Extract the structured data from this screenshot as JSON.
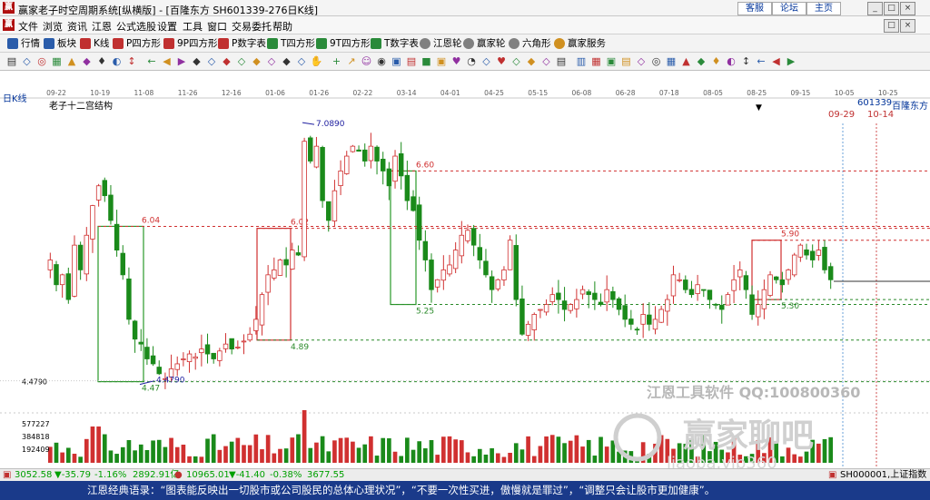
{
  "window": {
    "title": "赢家老子时空周期系统[纵横版] - [百隆东方 SH601339-276日K线]",
    "logo": "赢",
    "links": [
      "客服",
      "论坛",
      "主页"
    ]
  },
  "menu": {
    "items": [
      "文件",
      "浏览",
      "资讯",
      "江恩",
      "公式选股",
      "设置",
      "工具",
      "窗口",
      "交易委托",
      "帮助"
    ]
  },
  "toolbar": {
    "items": [
      {
        "label": "行情",
        "color": "#2a5caa"
      },
      {
        "label": "板块",
        "color": "#2a5caa"
      },
      {
        "label": "K线",
        "color": "#c03030"
      },
      {
        "label": "P四方形",
        "color": "#c03030"
      },
      {
        "label": "9P四方形",
        "color": "#c03030"
      },
      {
        "label": "P数字表",
        "color": "#c03030"
      },
      {
        "label": "T四方形",
        "color": "#2a8a3a"
      },
      {
        "label": "9T四方形",
        "color": "#2a8a3a"
      },
      {
        "label": "T数字表",
        "color": "#2a8a3a"
      },
      {
        "label": "江恩轮",
        "color": "#808080"
      },
      {
        "label": "赢家轮",
        "color": "#808080"
      },
      {
        "label": "六角形",
        "color": "#808080"
      },
      {
        "label": "赢家服务",
        "color": "#d09020"
      }
    ]
  },
  "chart_header": {
    "period_label": "日K线",
    "structure_label": "老子十二宫结构",
    "code": "601339",
    "name": "百隆东方",
    "future_date_1": "09-29",
    "future_date_2": "10-14"
  },
  "date_axis": [
    "09-22",
    "10-19",
    "11-08",
    "11-26",
    "12-16",
    "01-06",
    "01-26",
    "02-22",
    "03-14",
    "04-01",
    "04-25",
    "05-15",
    "06-08",
    "06-28",
    "07-18",
    "08-05",
    "08-25",
    "09-15",
    "10-05",
    "10-25"
  ],
  "volume_axis": [
    "577227",
    "384818",
    "192409"
  ],
  "watermark": {
    "line1": "江恩工具软件  QQ:100800360",
    "line2": "赢家聊吧",
    "line3": "liaoba.vip360"
  },
  "index_bar": {
    "sh_value": "3052.58",
    "sh_change": "▼-35.79",
    "sh_pct": "-1.16%",
    "sh_amount": "2892.91亿",
    "sz_value": "10965.01",
    "sz_change": "▼-41.40",
    "sz_pct": "-0.38%",
    "sz_amount": "3677.55",
    "right_label": "SH000001,上证指数"
  },
  "quote_text": "江恩经典语录：“图表能反映出一切股市或公司股民的总体心理状况”，“不要一次性买进，傲慢就是罪过”，“调整只会让股市更加健康”。",
  "chart_data": {
    "type": "candlestick",
    "title": "老子十二宫结构",
    "y_range": [
      4.2,
      7.2
    ],
    "price_markers": {
      "low_label": "4.4790",
      "low_value": 4.479,
      "high_label": "7.0890",
      "high_value": 7.089,
      "axis_label": "4.4790"
    },
    "levels": [
      {
        "label": "6.04",
        "value": 6.04,
        "color": "#d03030"
      },
      {
        "label": "4.47",
        "value": 4.47,
        "color": "#2a8a2a"
      },
      {
        "label": "6.02",
        "value": 6.02,
        "color": "#d03030"
      },
      {
        "label": "4.89",
        "value": 4.89,
        "color": "#2a8a2a"
      },
      {
        "label": "6.60",
        "value": 6.6,
        "color": "#d03030"
      },
      {
        "label": "5.25",
        "value": 5.25,
        "color": "#2a8a2a"
      },
      {
        "label": "5.90",
        "value": 5.9,
        "color": "#d03030"
      },
      {
        "label": "5.30",
        "value": 5.3,
        "color": "#2a8a2a"
      }
    ],
    "series_close": [
      5.7,
      5.45,
      5.55,
      5.3,
      5.85,
      5.6,
      5.95,
      6.25,
      6.45,
      6.35,
      6.1,
      5.8,
      5.55,
      5.1,
      4.9,
      4.85,
      4.7,
      4.65,
      4.55,
      4.5,
      4.6,
      4.65,
      4.7,
      4.75,
      4.72,
      4.8,
      4.75,
      4.7,
      4.78,
      4.85,
      4.8,
      4.82,
      4.88,
      4.95,
      5.1,
      5.35,
      5.55,
      5.6,
      5.7,
      5.65,
      5.8,
      5.75,
      6.9,
      6.7,
      6.85,
      6.3,
      6.1,
      6.4,
      6.6,
      6.75,
      6.85,
      6.8,
      6.7,
      6.85,
      6.7,
      6.6,
      6.45,
      6.75,
      6.55,
      6.3,
      6.2,
      5.9,
      5.7,
      5.4,
      5.5,
      5.6,
      5.65,
      5.8,
      5.95,
      6.0,
      5.85,
      5.7,
      5.55,
      5.4,
      5.5,
      5.6,
      5.9,
      5.3,
      4.95,
      5.05,
      5.15,
      5.2,
      5.25,
      5.35,
      5.3,
      5.2,
      5.25,
      5.3,
      5.4,
      5.35,
      5.3,
      5.25,
      5.4,
      5.3,
      5.2,
      5.1,
      5.05,
      5.0,
      5.15,
      5.05,
      5.1,
      5.2,
      5.3,
      5.55,
      5.5,
      5.4,
      5.35,
      5.45,
      5.4,
      5.3,
      5.25,
      5.2,
      5.35,
      5.5,
      5.6,
      5.4,
      5.15,
      5.25,
      5.4,
      5.55,
      5.5,
      5.45,
      5.6,
      5.75,
      5.85,
      5.75,
      5.7,
      5.8,
      5.6,
      5.5
    ]
  }
}
